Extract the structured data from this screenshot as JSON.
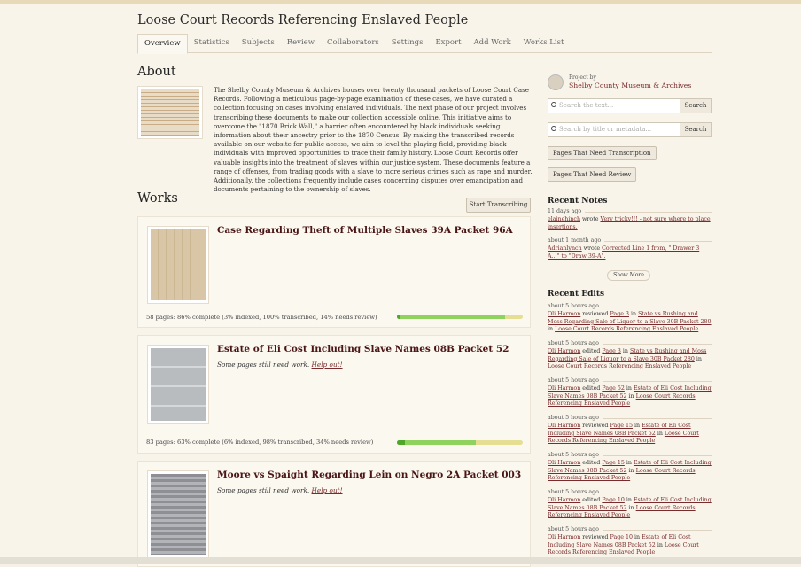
{
  "title": "Loose Court Records Referencing Enslaved People",
  "tabs": [
    "Overview",
    "Statistics",
    "Subjects",
    "Review",
    "Collaborators",
    "Settings",
    "Export",
    "Add Work",
    "Works List"
  ],
  "about": {
    "heading": "About",
    "text": "The Shelby County Museum & Archives houses over twenty thousand packets of Loose Court Case Records. Following a meticulous page-by-page examination of these cases, we have curated a collection focusing on cases involving enslaved individuals. The next phase of our project involves transcribing these documents to make our collection accessible online. This initiative aims to overcome the \"1870 Brick Wall,\" a barrier often encountered by black individuals seeking information about their ancestry prior to the 1870 Census. By making the transcribed records available on our website for public access, we aim to level the playing field, providing black individuals with improved opportunities to trace their family history. Loose Court Records offer valuable insights into the treatment of slaves within our justice system. These documents feature a range of offenses, from trading goods with a slave to more serious crimes such as rape and murder. Additionally, the collections frequently include cases concerning disputes over emancipation and documents pertaining to the ownership of slaves."
  },
  "works": {
    "heading": "Works",
    "start_label": "Start Transcribing",
    "items": [
      {
        "title": "Case Regarding Theft of Multiple Slaves 39A Packet 96A",
        "subtitle": "",
        "help": "",
        "stats": "58 pages: 86% complete (3% indexed, 100% transcribed, 14% needs review)",
        "indexed": 3,
        "complete": 86
      },
      {
        "title": "Estate of Eli Cost Including Slave Names 08B Packet 52",
        "subtitle": "Some pages still need work.",
        "help": "Help out!",
        "stats": "83 pages: 63% complete (6% indexed, 98% transcribed, 34% needs review)",
        "indexed": 6,
        "complete": 63
      },
      {
        "title": "Moore vs Spaight Regarding Lein on Negro 2A Packet 003",
        "subtitle": "Some pages still need work.",
        "help": "Help out!",
        "stats": "",
        "indexed": 0,
        "complete": 0
      }
    ]
  },
  "sidebar": {
    "project_by": "Project by",
    "owner": "Shelby County Museum & Archives",
    "search_text_placeholder": "Search the text...",
    "search_meta_placeholder": "Search by title or metadata...",
    "search_label": "Search",
    "need_transcription": "Pages That Need Transcription",
    "need_review": "Pages That Need Review",
    "notes_heading": "Recent Notes",
    "notes": [
      {
        "when": "11 days ago",
        "user": "elainehinch",
        "verb": "wrote",
        "text": "Very tricky!!! - not sure where to place insertions."
      },
      {
        "when": "about 1 month ago",
        "user": "Adrianlynch",
        "verb": "wrote",
        "text": "Corrected Line 1 from, \" Drawer 3 A...\" to \"Draw 39-A\"."
      }
    ],
    "show_more": "Show More",
    "edits_heading": "Recent Edits",
    "edits": [
      {
        "when": "about 5 hours ago",
        "user": "Oli Harmon",
        "verb": "reviewed",
        "page": "Page 3",
        "work": "State vs Rushing and Moss Regarding Sale of Liquor to a Slave 30B Packet 280",
        "collection": "Loose Court Records Referencing Enslaved People"
      },
      {
        "when": "about 5 hours ago",
        "user": "Oli Harmon",
        "verb": "edited",
        "page": "Page 3",
        "work": "State vs Rushing and Moss Regarding Sale of Liquor to a Slave 30B Packet 280",
        "collection": "Loose Court Records Referencing Enslaved People"
      },
      {
        "when": "about 5 hours ago",
        "user": "Oli Harmon",
        "verb": "edited",
        "page": "Page 52",
        "work": "Estate of Eli Cost Including Slave Names 08B Packet 52",
        "collection": "Loose Court Records Referencing Enslaved People"
      },
      {
        "when": "about 5 hours ago",
        "user": "Oli Harmon",
        "verb": "reviewed",
        "page": "Page 15",
        "work": "Estate of Eli Cost Including Slave Names 08B Packet 52",
        "collection": "Loose Court Records Referencing Enslaved People"
      },
      {
        "when": "about 5 hours ago",
        "user": "Oli Harmon",
        "verb": "edited",
        "page": "Page 15",
        "work": "Estate of Eli Cost Including Slave Names 08B Packet 52",
        "collection": "Loose Court Records Referencing Enslaved People"
      },
      {
        "when": "about 5 hours ago",
        "user": "Oli Harmon",
        "verb": "edited",
        "page": "Page 10",
        "work": "Estate of Eli Cost Including Slave Names 08B Packet 52",
        "collection": "Loose Court Records Referencing Enslaved People"
      },
      {
        "when": "about 5 hours ago",
        "user": "Oli Harmon",
        "verb": "reviewed",
        "page": "Page 10",
        "work": "Estate of Eli Cost Including Slave Names 08B Packet 52",
        "collection": "Loose Court Records Referencing Enslaved People"
      }
    ],
    "in_word": "in"
  },
  "colors": {
    "link": "#7a2b2b",
    "bar_green": "#8fd35e",
    "bar_dark": "#4da82a",
    "bar_yellow": "#e6df93"
  }
}
